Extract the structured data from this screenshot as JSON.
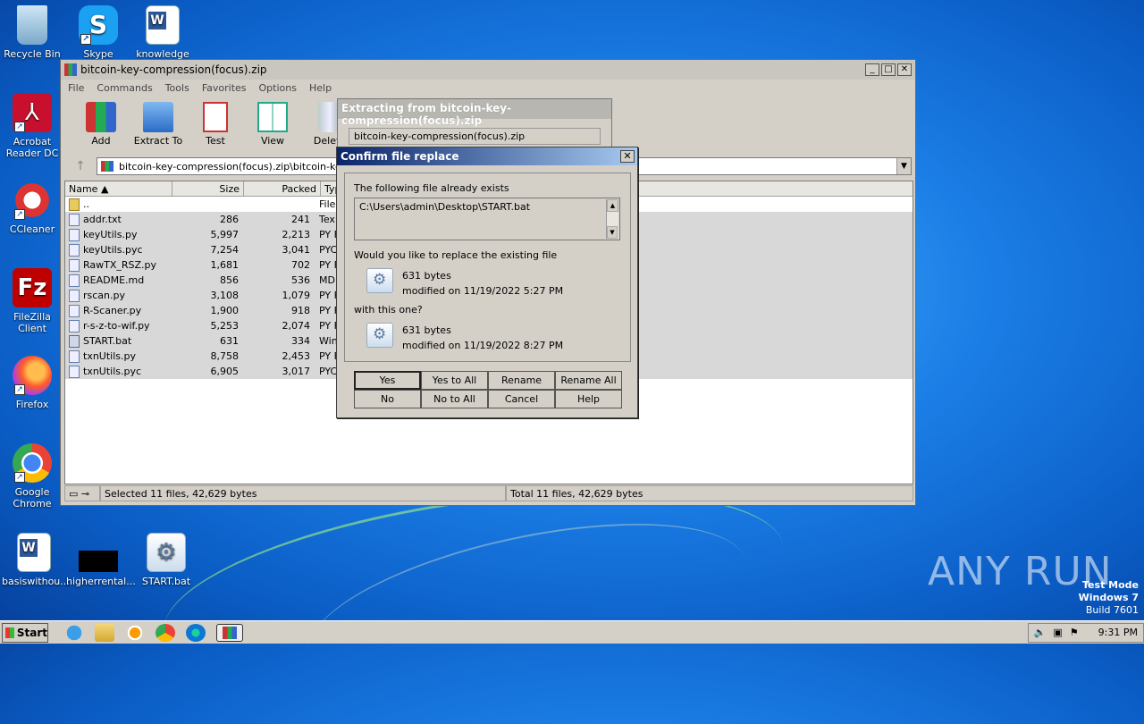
{
  "desktop": {
    "icons": [
      {
        "label": "Recycle Bin"
      },
      {
        "label": "Skype"
      },
      {
        "label": "knowledge"
      },
      {
        "label": "Acrobat Reader DC"
      },
      {
        "label": "CCleaner"
      },
      {
        "label": "FileZilla Client"
      },
      {
        "label": "Firefox"
      },
      {
        "label": "Google Chrome"
      },
      {
        "label": "basiswithou..."
      },
      {
        "label": "higherrental..."
      },
      {
        "label": "START.bat"
      }
    ],
    "watermark": "ANY RUN",
    "test_mode": {
      "line1": "Test Mode",
      "line2": "Windows 7",
      "line3": "Build 7601"
    }
  },
  "winrar": {
    "title": "bitcoin-key-compression(focus).zip",
    "menu": [
      "File",
      "Commands",
      "Tools",
      "Favorites",
      "Options",
      "Help"
    ],
    "toolbar": [
      "Add",
      "Extract To",
      "Test",
      "View",
      "Delete"
    ],
    "address": "bitcoin-key-compression(focus).zip\\bitcoin-key-c",
    "columns": {
      "name": "Name",
      "size": "Size",
      "packed": "Packed",
      "type": "Typ"
    },
    "files": [
      {
        "name": "..",
        "size": "",
        "packed": "",
        "type": "File"
      },
      {
        "name": "addr.txt",
        "size": "286",
        "packed": "241",
        "type": "Tex"
      },
      {
        "name": "keyUtils.py",
        "size": "5,997",
        "packed": "2,213",
        "type": "PY F"
      },
      {
        "name": "keyUtils.pyc",
        "size": "7,254",
        "packed": "3,041",
        "type": "PYC"
      },
      {
        "name": "RawTX_RSZ.py",
        "size": "1,681",
        "packed": "702",
        "type": "PY F"
      },
      {
        "name": "README.md",
        "size": "856",
        "packed": "536",
        "type": "MD"
      },
      {
        "name": "rscan.py",
        "size": "3,108",
        "packed": "1,079",
        "type": "PY F"
      },
      {
        "name": "R-Scaner.py",
        "size": "1,900",
        "packed": "918",
        "type": "PY F"
      },
      {
        "name": "r-s-z-to-wif.py",
        "size": "5,253",
        "packed": "2,074",
        "type": "PY F"
      },
      {
        "name": "START.bat",
        "size": "631",
        "packed": "334",
        "type": "Win"
      },
      {
        "name": "txnUtils.py",
        "size": "8,758",
        "packed": "2,453",
        "type": "PY F"
      },
      {
        "name": "txnUtils.pyc",
        "size": "6,905",
        "packed": "3,017",
        "type": "PYC"
      }
    ],
    "status_left": "Selected 11 files, 42,629 bytes",
    "status_right": "Total 11 files, 42,629 bytes"
  },
  "extract_dialog": {
    "title": "Extracting from bitcoin-key-compression(focus).zip",
    "file": "bitcoin-key-compression(focus).zip"
  },
  "confirm_dialog": {
    "title": "Confirm file replace",
    "exists_label": "The following file already exists",
    "path": "C:\\Users\\admin\\Desktop\\START.bat",
    "question": "Would you like to replace the existing file",
    "existing": {
      "size": "631 bytes",
      "modified": "modified on 11/19/2022 5:27 PM"
    },
    "with_label": "with this one?",
    "new": {
      "size": "631 bytes",
      "modified": "modified on 11/19/2022 8:27 PM"
    },
    "buttons": {
      "yes": "Yes",
      "yes_all": "Yes to All",
      "rename": "Rename",
      "rename_all": "Rename All",
      "no": "No",
      "no_all": "No to All",
      "cancel": "Cancel",
      "help": "Help"
    }
  },
  "taskbar": {
    "start": "Start",
    "clock": "9:31 PM"
  }
}
